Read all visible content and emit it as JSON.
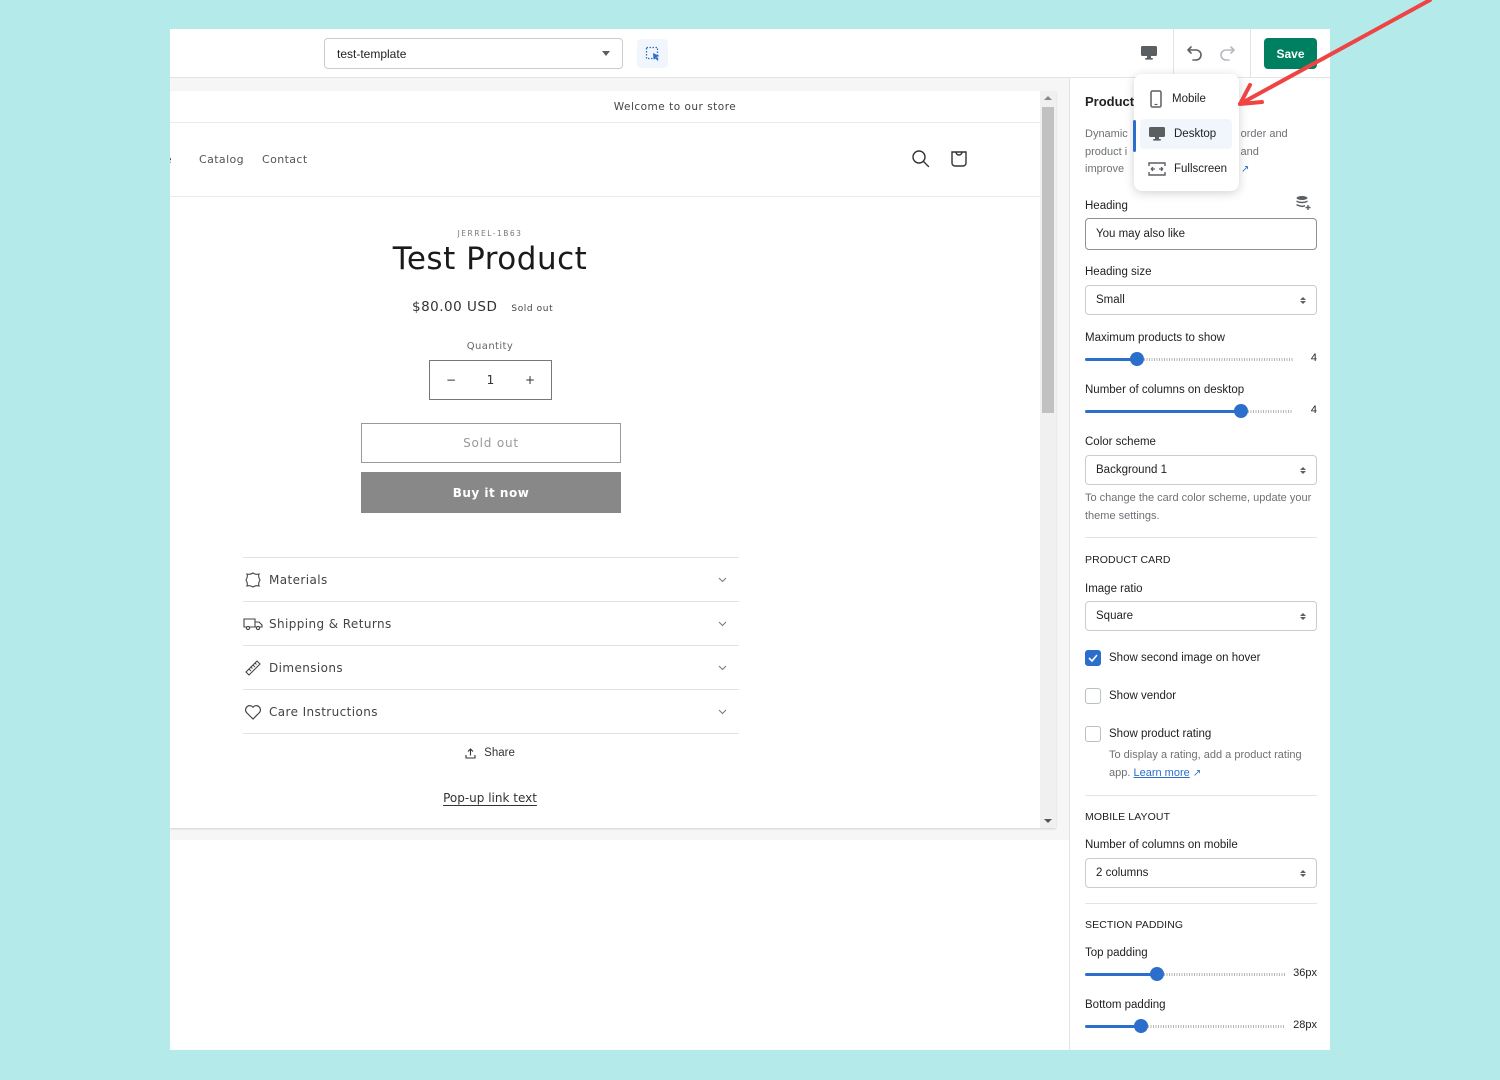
{
  "topbar": {
    "template_select": "test-template",
    "save_label": "Save",
    "icons": {
      "inspector": "select-element-icon",
      "device": "desktop-icon",
      "undo": "undo-icon",
      "redo": "redo-icon"
    }
  },
  "device_menu": {
    "items": [
      {
        "label": "Mobile",
        "icon": "mobile-icon",
        "active": false
      },
      {
        "label": "Desktop",
        "icon": "desktop-icon",
        "active": true
      },
      {
        "label": "Fullscreen",
        "icon": "fullscreen-icon",
        "active": false
      }
    ]
  },
  "preview": {
    "announcement": "Welcome to our store",
    "nav": [
      "Home",
      "Catalog",
      "Contact"
    ],
    "header_icons": [
      "search-icon",
      "cart-icon"
    ],
    "product": {
      "vendor": "JERREL-1B63",
      "title": "Test Product",
      "price": "$80.00 USD",
      "badge": "Sold out",
      "quantity_label": "Quantity",
      "quantity_value": "1",
      "qty_minus": "−",
      "qty_plus": "+",
      "sold_out_button": "Sold out",
      "buy_now_button": "Buy it now"
    },
    "accordion": [
      {
        "label": "Materials",
        "icon": "leather-icon"
      },
      {
        "label": "Shipping & Returns",
        "icon": "truck-icon"
      },
      {
        "label": "Dimensions",
        "icon": "ruler-icon"
      },
      {
        "label": "Care Instructions",
        "icon": "heart-icon"
      }
    ],
    "share_label": "Share",
    "popup_link": "Pop-up link text"
  },
  "settings": {
    "title": "Product",
    "description_visible": [
      "Dynamic",
      "use order and",
      "product i",
      "ge and",
      "improve",
      "re"
    ],
    "heading_label": "Heading",
    "heading_value": "You may also like",
    "heading_size_label": "Heading size",
    "heading_size_value": "Small",
    "max_products_label": "Maximum products to show",
    "max_products_value": "4",
    "max_products_fraction": 0.25,
    "columns_desktop_label": "Number of columns on desktop",
    "columns_desktop_value": "4",
    "columns_desktop_fraction": 0.75,
    "color_scheme_label": "Color scheme",
    "color_scheme_value": "Background 1",
    "color_scheme_help": "To change the card color scheme, update your theme settings.",
    "product_card_section": "PRODUCT CARD",
    "image_ratio_label": "Image ratio",
    "image_ratio_value": "Square",
    "checkboxes": [
      {
        "label": "Show second image on hover",
        "checked": true
      },
      {
        "label": "Show vendor",
        "checked": false
      },
      {
        "label": "Show product rating",
        "checked": false
      }
    ],
    "rating_help": "To display a rating, add a product rating app.",
    "rating_help_link": "Learn more",
    "mobile_layout_section": "MOBILE LAYOUT",
    "columns_mobile_label": "Number of columns on mobile",
    "columns_mobile_value": "2 columns",
    "section_padding_section": "SECTION PADDING",
    "top_padding_label": "Top padding",
    "top_padding_value": "36px",
    "top_padding_fraction": 0.36,
    "bottom_padding_label": "Bottom padding",
    "bottom_padding_value": "28px",
    "bottom_padding_fraction": 0.28
  },
  "colors": {
    "background": "#b4ebea",
    "save": "#008060",
    "accent": "#2c6ecb",
    "annotation_arrow": "#ef4444"
  }
}
